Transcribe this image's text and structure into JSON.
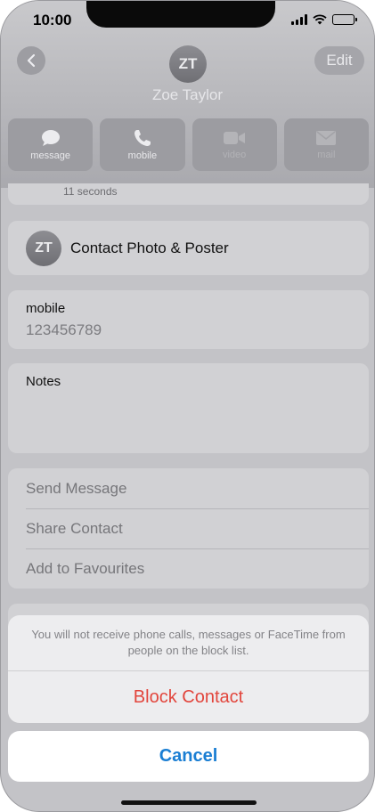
{
  "status_bar": {
    "time": "10:00"
  },
  "header": {
    "initials": "ZT",
    "name": "Zoe Taylor",
    "edit_label": "Edit"
  },
  "actions": [
    {
      "label": "message",
      "icon": "message-bubble-icon",
      "enabled": true
    },
    {
      "label": "mobile",
      "icon": "phone-icon",
      "enabled": true
    },
    {
      "label": "video",
      "icon": "video-camera-icon",
      "enabled": false
    },
    {
      "label": "mail",
      "icon": "envelope-icon",
      "enabled": false
    }
  ],
  "call_info": {
    "duration": "11 seconds"
  },
  "contact_photo": {
    "initials": "ZT",
    "label": "Contact Photo & Poster"
  },
  "phone": {
    "label": "mobile",
    "number": "123456789"
  },
  "notes": {
    "label": "Notes"
  },
  "options": [
    {
      "label": "Send Message"
    },
    {
      "label": "Share Contact"
    },
    {
      "label": "Add to Favourites"
    }
  ],
  "action_sheet": {
    "message": "You will not receive phone calls, messages or FaceTime from people on the block list.",
    "destructive_label": "Block Contact",
    "cancel_label": "Cancel"
  },
  "colors": {
    "destructive": "#e2453c",
    "accent": "#1a7ed3"
  }
}
